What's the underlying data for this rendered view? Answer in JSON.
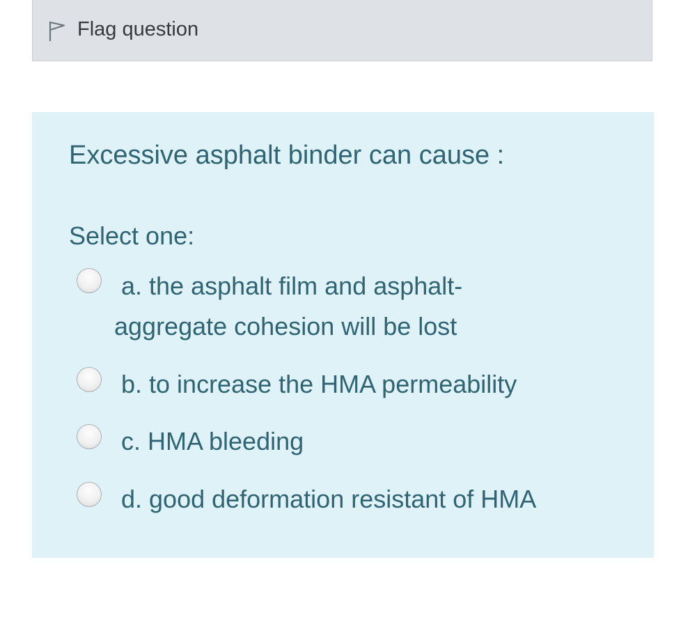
{
  "flag": {
    "label": "Flag question",
    "icon": "flag-icon"
  },
  "question": {
    "text": "Excessive asphalt binder can cause :",
    "prompt": "Select one:",
    "options": [
      {
        "line1": "a. the asphalt film and asphalt-",
        "line2": "aggregate cohesion will be lost"
      },
      {
        "line1": "b. to increase the HMA permeability"
      },
      {
        "line1": "c. HMA bleeding"
      },
      {
        "line1": "d. good deformation resistant of HMA"
      }
    ]
  },
  "colors": {
    "question_background": "#def2f8",
    "question_text": "#2f6473",
    "flag_bar_background": "#dee2e6"
  }
}
